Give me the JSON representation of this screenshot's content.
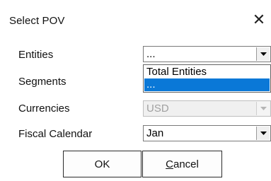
{
  "dialog": {
    "title": "Select POV",
    "close_glyph": "✕"
  },
  "fields": {
    "entities": {
      "label": "Entities",
      "value": "..."
    },
    "segments": {
      "label": "Segments"
    },
    "currencies": {
      "label": "Currencies",
      "value": "USD",
      "disabled": true
    },
    "fiscal_calendar": {
      "label": "Fiscal Calendar",
      "value": "Jan"
    }
  },
  "entities_dropdown": {
    "options": [
      "Total Entities",
      "..."
    ],
    "selected_index": 1
  },
  "buttons": {
    "ok": "OK",
    "cancel_mnemonic": "C",
    "cancel_rest": "ancel"
  },
  "colors": {
    "selection": "#0a78d7",
    "disabled_text": "#a0a0a0"
  },
  "icons": {
    "close": "close-icon",
    "dropdown_arrow": "chevron-down-icon"
  }
}
